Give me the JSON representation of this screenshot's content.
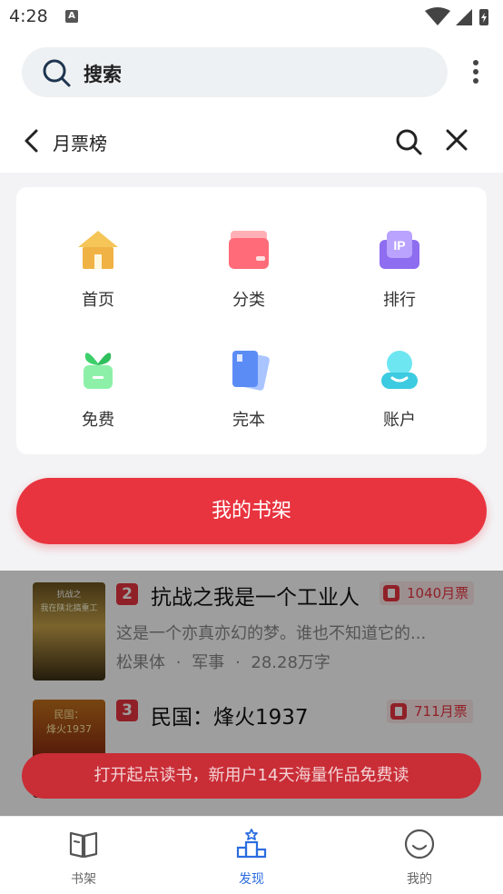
{
  "status_bar": {
    "time": "4:28",
    "notif_badge": "A"
  },
  "search": {
    "placeholder": "搜索"
  },
  "nav": {
    "title": "月票榜"
  },
  "grid": [
    {
      "label": "首页",
      "icon": "home-icon"
    },
    {
      "label": "分类",
      "icon": "category-icon"
    },
    {
      "label": "排行",
      "icon": "ranking-icon"
    },
    {
      "label": "免费",
      "icon": "free-icon"
    },
    {
      "label": "完本",
      "icon": "completed-icon"
    },
    {
      "label": "账户",
      "icon": "account-icon"
    }
  ],
  "shelf_button": {
    "label": "我的书架"
  },
  "books": [
    {
      "rank": "2",
      "title": "抗战之我是一个工业人",
      "votes": "1040月票",
      "desc": "这是一个亦真亦幻的梦。谁也不知道它的...",
      "author": "松果体",
      "genre": "军事",
      "words": "28.28万字",
      "cover_line1": "抗战之",
      "cover_line2": "我在陕北搞重工"
    },
    {
      "rank": "3",
      "title": "民国：烽火1937",
      "votes": "711月票",
      "cover_line1": "民国：",
      "cover_line2": "烽火1937"
    }
  ],
  "meta_separator": "·",
  "promo": {
    "text": "打开起点读书，新用户14天海量作品免费读"
  },
  "tabs": [
    {
      "label": "书架",
      "icon": "bookshelf-icon"
    },
    {
      "label": "发现",
      "icon": "discover-icon",
      "active": true
    },
    {
      "label": "我的",
      "icon": "profile-icon"
    }
  ],
  "colors": {
    "accent": "#e8343f",
    "tab_active": "#2b6de0"
  }
}
